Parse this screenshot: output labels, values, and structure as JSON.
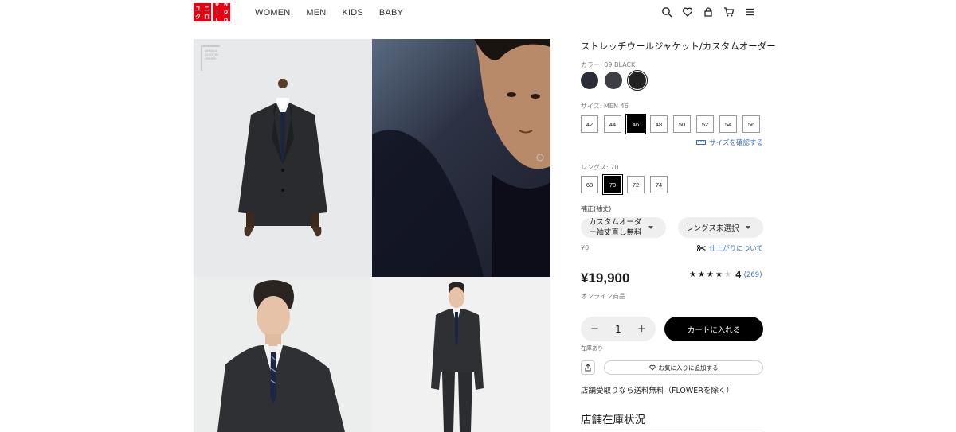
{
  "header": {
    "logo_chars": [
      "ユ",
      "ニ",
      "ク",
      "ロ",
      "U",
      "N",
      "I",
      "Q",
      "L",
      "O"
    ],
    "nav": [
      "WOMEN",
      "MEN",
      "KIDS",
      "BABY"
    ],
    "icons": [
      "search-icon",
      "heart-icon",
      "user-icon",
      "cart-icon",
      "menu-icon"
    ]
  },
  "gallery": {
    "badge": [
      "UNIQLO",
      "CUSTOM",
      "ORDER"
    ]
  },
  "product": {
    "title": "ストレッチウールジャケット/カスタムオーダー",
    "color_label": "カラー: 09 BLACK",
    "colors": [
      "#2a2d38",
      "#3d3f45",
      "#222222"
    ],
    "selected_color_index": 2,
    "size_label": "サイズ: MEN 46",
    "sizes": [
      "42",
      "44",
      "46",
      "48",
      "50",
      "52",
      "54",
      "56"
    ],
    "selected_size": "46",
    "size_guide": "サイズを確認する",
    "length_label": "レングス: 70",
    "lengths": [
      "68",
      "70",
      "72",
      "74"
    ],
    "selected_length": "70",
    "alteration_label": "補正(袖丈)",
    "alteration_select_line1": "カスタムオーダ",
    "alteration_select_line2": "ー袖丈直し無料",
    "length_select": "レングス未選択",
    "alteration_price": "¥0",
    "finish_link": "仕上がりについて",
    "price": "¥19,900",
    "online_only": "オンライン商品",
    "rating_value": "4",
    "rating_stars": 4,
    "rating_count": "(269)",
    "quantity": "1",
    "qty_minus": "−",
    "qty_plus": "+",
    "add_to_cart": "カートに入れる",
    "stock_status": "在庫あり",
    "add_favorite": "お気に入りに追加する",
    "shipping_note": "店舗受取りなら送料無料（FLOWERを除く）",
    "store_stock_title": "店舗在庫状況"
  }
}
